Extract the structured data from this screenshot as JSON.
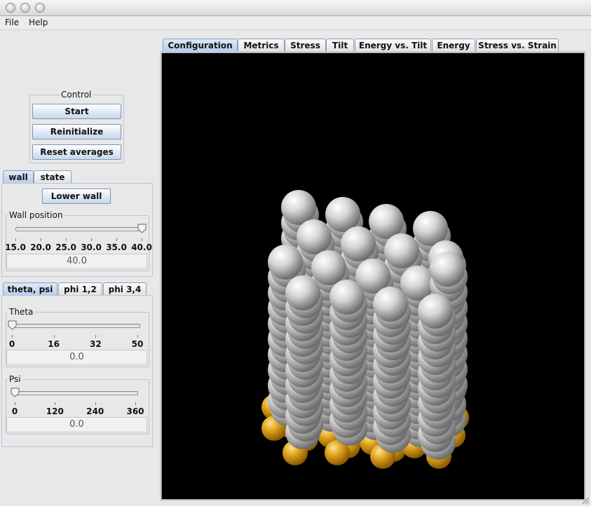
{
  "menu": {
    "file": "File",
    "help": "Help"
  },
  "control": {
    "title": "Control",
    "start": "Start",
    "reinitialize": "Reinitialize",
    "reset_averages": "Reset averages"
  },
  "wall_tabs": {
    "wall": "wall",
    "state": "state"
  },
  "wall": {
    "lower_button": "Lower wall",
    "slider_title": "Wall position",
    "ticks": [
      "15.0",
      "20.0",
      "25.0",
      "30.0",
      "35.0",
      "40.0"
    ],
    "value": "40.0",
    "min": 15,
    "max": 40,
    "current": 40
  },
  "angle_tabs": {
    "theta_psi": "theta, psi",
    "phi12": "phi 1,2",
    "phi34": "phi 3,4"
  },
  "theta": {
    "title": "Theta",
    "ticks": [
      "0",
      "16",
      "32",
      "50"
    ],
    "value": "0.0",
    "min": 0,
    "max": 50,
    "current": 0
  },
  "psi": {
    "title": "Psi",
    "ticks": [
      "0",
      "120",
      "240",
      "360"
    ],
    "value": "0.0",
    "min": 0,
    "max": 360,
    "current": 0
  },
  "tabs": [
    "Configuration",
    "Metrics",
    "Stress",
    "Tilt",
    "Energy vs. Tilt",
    "Energy",
    "Stress vs. Strain"
  ],
  "colors": {
    "molecule": "#c8c8c8",
    "substrate": "#e0a020",
    "background": "#000000"
  }
}
